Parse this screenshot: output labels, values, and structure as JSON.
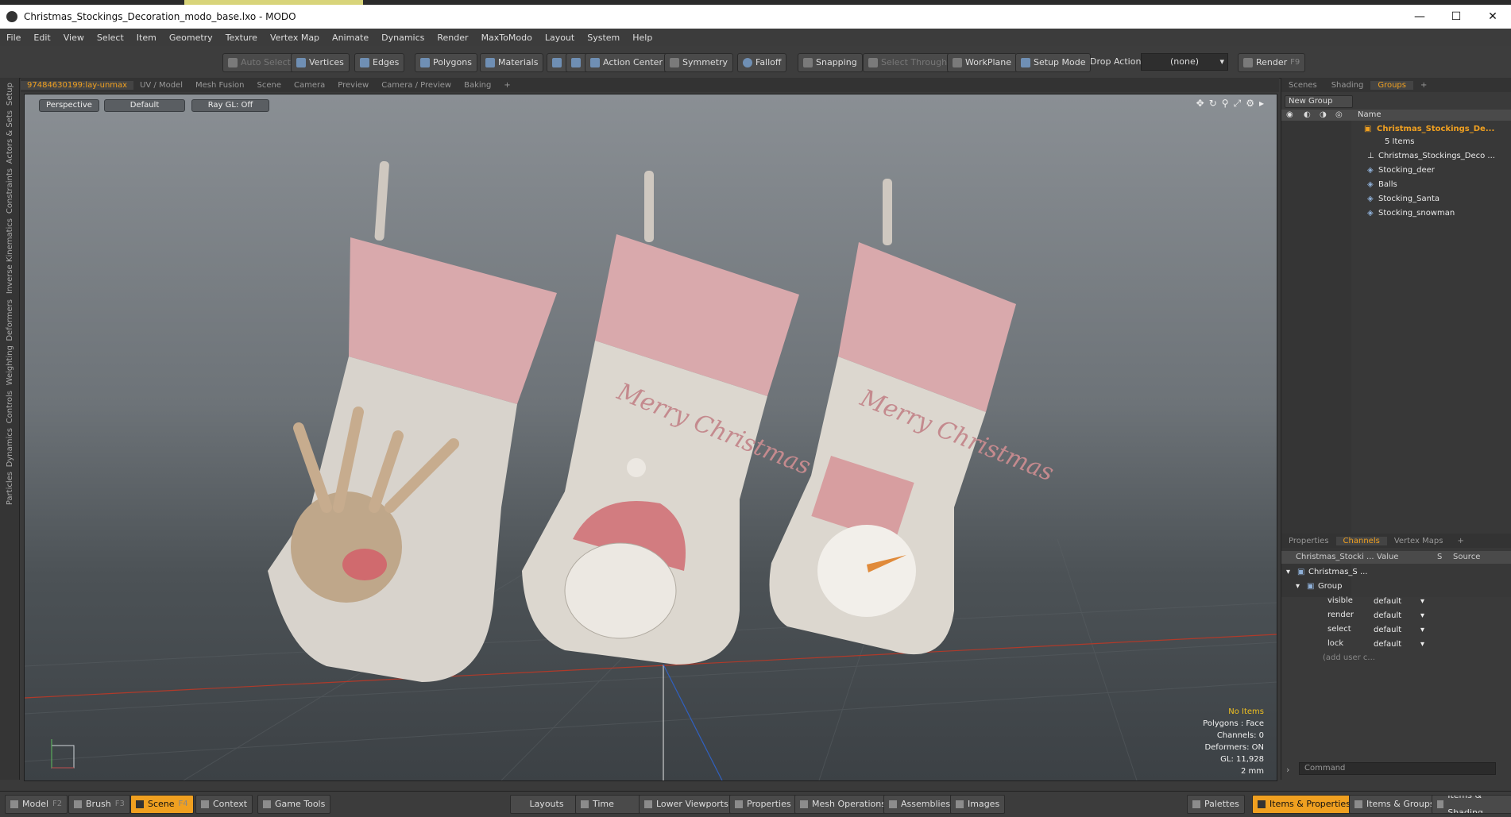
{
  "window": {
    "title": "Christmas_Stockings_Decoration_modo_base.lxo - MODO",
    "min": "—",
    "max": "☐",
    "close": "✕"
  },
  "menu": [
    "File",
    "Edit",
    "View",
    "Select",
    "Item",
    "Geometry",
    "Texture",
    "Vertex Map",
    "Animate",
    "Dynamics",
    "Render",
    "MaxToModo",
    "Layout",
    "System",
    "Help"
  ],
  "toolbar": {
    "auto_select": "Auto Select",
    "vertices": "Vertices",
    "edges": "Edges",
    "polygons": "Polygons",
    "materials": "Materials",
    "action_center": "Action Center",
    "symmetry": "Symmetry",
    "falloff": "Falloff",
    "snapping": "Snapping",
    "select_through": "Select Through",
    "workplane": "WorkPlane",
    "setup_mode": "Setup Mode",
    "drop_action": "Drop Action",
    "drop_value": "(none)",
    "render": "Render",
    "render_key": "F9"
  },
  "left_rail": [
    "Setup",
    "Actors & Sets",
    "Constraints",
    "Inverse Kinematics",
    "Deformers",
    "Weighting",
    "Controls",
    "Dynamics",
    "Particles"
  ],
  "viewport_tabs": [
    "97484630199:lay-unmax",
    "UV / Model",
    "Mesh Fusion",
    "Scene",
    "Camera",
    "Preview",
    "Camera / Preview",
    "Baking",
    "+"
  ],
  "viewport": {
    "projection": "Perspective",
    "shading": "Default",
    "raygl": "Ray GL: Off",
    "stocking_text_1": "Merry Christmas",
    "stocking_text_2": "Merry Christmas",
    "info": {
      "items": "No Items",
      "polygons": "Polygons : Face",
      "channels": "Channels: 0",
      "deformers": "Deformers: ON",
      "gl": "GL: 11,928",
      "scale": "2 mm"
    }
  },
  "right_tabs_top": [
    "Scenes",
    "Shading",
    "Groups",
    "+"
  ],
  "groups": {
    "new_group": "New Group",
    "name_header": "Name",
    "root": "Christmas_Stockings_De...",
    "root_count": "5 Items",
    "children": [
      "Christmas_Stockings_Deco ...",
      "Stocking_deer",
      "Balls",
      "Stocking_Santa",
      "Stocking_snowman"
    ]
  },
  "right_tabs_bottom": [
    "Properties",
    "Channels",
    "Vertex Maps",
    "+"
  ],
  "channels": {
    "headers": [
      "Christmas_Stocki ...",
      "Value",
      "S",
      "Source"
    ],
    "item": "Christmas_S ...",
    "group": "Group",
    "rows": [
      {
        "name": "visible",
        "value": "default"
      },
      {
        "name": "render",
        "value": "default"
      },
      {
        "name": "select",
        "value": "default"
      },
      {
        "name": "lock",
        "value": "default"
      }
    ],
    "add_user": "(add user c...",
    "command_placeholder": "Command"
  },
  "bottom": {
    "model": "Model",
    "model_key": "F2",
    "brush": "Brush",
    "brush_key": "F3",
    "scene": "Scene",
    "scene_key": "F4",
    "context": "Context",
    "game_tools": "Game Tools",
    "layouts": "Layouts",
    "time": "Time",
    "lower_viewports": "Lower Viewports",
    "properties": "Properties",
    "mesh_operations": "Mesh Operations",
    "assemblies": "Assemblies",
    "images": "Images",
    "palettes": "Palettes",
    "items_properties": "Items & Properties",
    "items_groups": "Items & Groups",
    "items_shading": "Items & Shading"
  }
}
